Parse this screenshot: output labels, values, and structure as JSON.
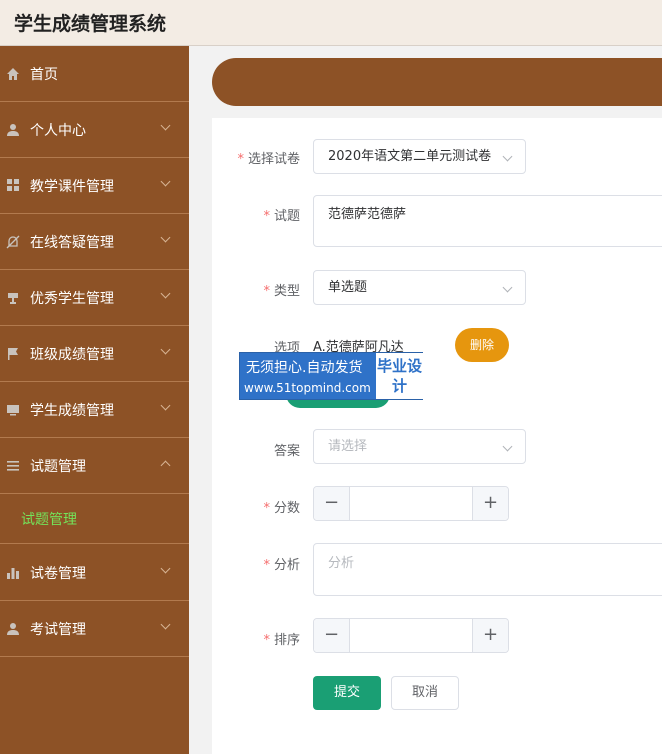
{
  "app": {
    "title": "学生成绩管理系统"
  },
  "sidebar": {
    "items": [
      {
        "label": "首页",
        "icon": "home-icon"
      },
      {
        "label": "个人中心",
        "icon": "user-icon"
      },
      {
        "label": "教学课件管理",
        "icon": "grid-icon"
      },
      {
        "label": "在线答疑管理",
        "icon": "bell-slash-icon"
      },
      {
        "label": "优秀学生管理",
        "icon": "trophy-icon"
      },
      {
        "label": "班级成绩管理",
        "icon": "flag-icon"
      },
      {
        "label": "学生成绩管理",
        "icon": "monitor-icon"
      },
      {
        "label": "试题管理",
        "icon": "list-icon"
      },
      {
        "label": "试卷管理",
        "icon": "bar-chart-icon"
      },
      {
        "label": "考试管理",
        "icon": "user-icon"
      }
    ],
    "submenu": {
      "label": "试题管理"
    }
  },
  "form": {
    "paper": {
      "label": "选择试卷",
      "value": "2020年语文第二单元测试卷"
    },
    "question": {
      "label": "试题",
      "value": "范德萨范德萨"
    },
    "type": {
      "label": "类型",
      "value": "单选题"
    },
    "options": {
      "label": "选项",
      "value": "A.范德萨阿凡达",
      "delete_label": "删除"
    },
    "answer": {
      "label": "答案",
      "placeholder": "请选择"
    },
    "score": {
      "label": "分数",
      "minus": "−",
      "plus": "+"
    },
    "analysis": {
      "label": "分析",
      "placeholder": "分析"
    },
    "order": {
      "label": "排序",
      "minus": "−",
      "plus": "+"
    },
    "submit_label": "提交",
    "cancel_label": "取消"
  },
  "watermark": {
    "line1": "无须担心.自动发货",
    "line2": "www.51topmind.com",
    "side": "毕业设计"
  },
  "colors": {
    "sidebar": "#8d5226",
    "primary": "#1a9f74",
    "warning": "#e6960e",
    "required": "#f56c6c",
    "active_submenu": "#74e35a"
  }
}
